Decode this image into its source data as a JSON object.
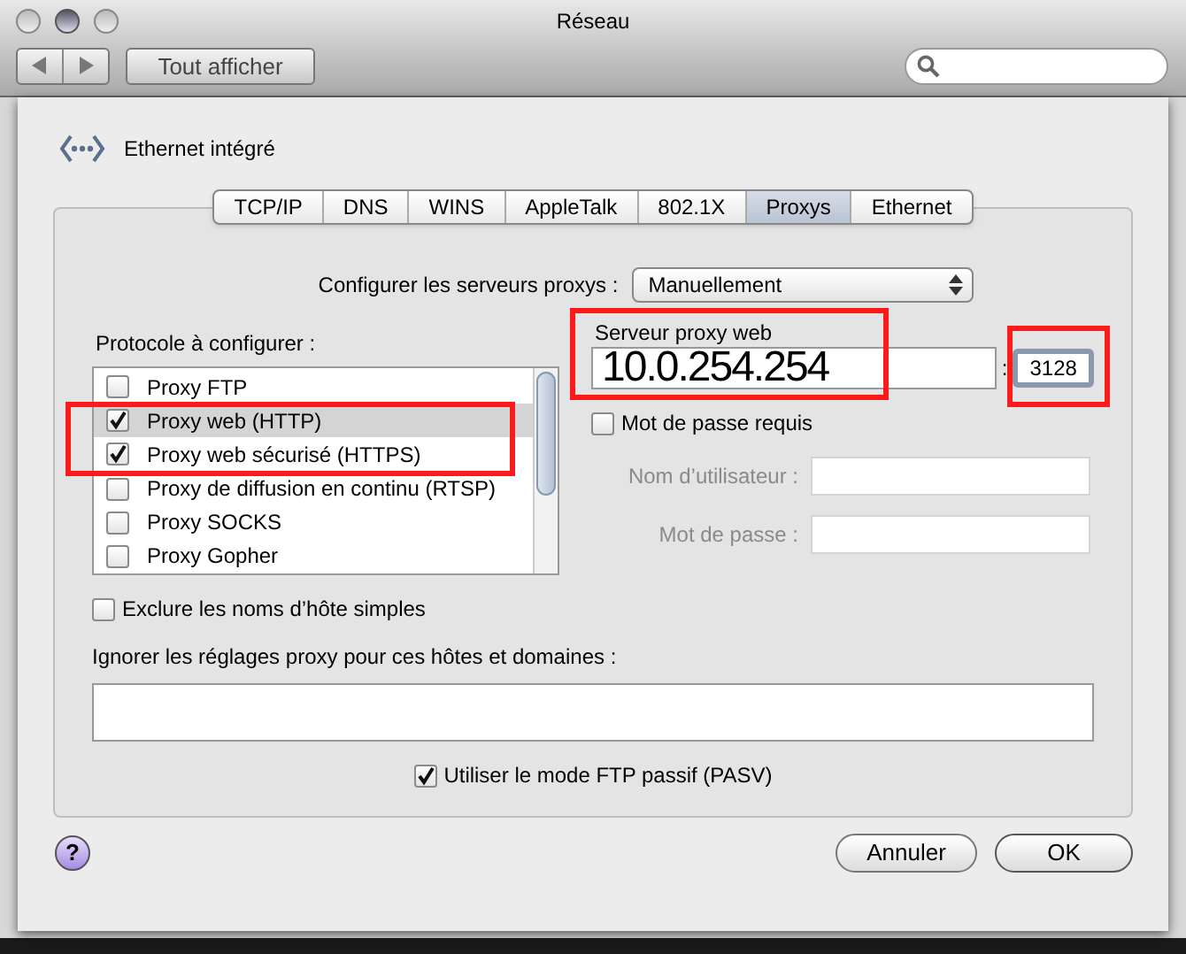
{
  "window": {
    "title": "Réseau"
  },
  "toolbar": {
    "show_all": "Tout afficher"
  },
  "service": {
    "name": "Ethernet intégré"
  },
  "tabs": [
    {
      "label": "TCP/IP",
      "selected": false
    },
    {
      "label": "DNS",
      "selected": false
    },
    {
      "label": "WINS",
      "selected": false
    },
    {
      "label": "AppleTalk",
      "selected": false
    },
    {
      "label": "802.1X",
      "selected": false
    },
    {
      "label": "Proxys",
      "selected": true
    },
    {
      "label": "Ethernet",
      "selected": false
    }
  ],
  "configure": {
    "label": "Configurer les serveurs proxys :",
    "value": "Manuellement"
  },
  "protocols": {
    "label": "Protocole à configurer :",
    "items": [
      {
        "label": "Proxy FTP",
        "checked": false,
        "selected": false
      },
      {
        "label": "Proxy web (HTTP)",
        "checked": true,
        "selected": true
      },
      {
        "label": "Proxy web sécurisé (HTTPS)",
        "checked": true,
        "selected": false
      },
      {
        "label": "Proxy de diffusion en continu (RTSP)",
        "checked": false,
        "selected": false
      },
      {
        "label": "Proxy SOCKS",
        "checked": false,
        "selected": false
      },
      {
        "label": "Proxy Gopher",
        "checked": false,
        "selected": false
      }
    ]
  },
  "server": {
    "label": "Serveur proxy web",
    "host": "10.0.254.254",
    "separator": ":",
    "port": "3128"
  },
  "password_required": {
    "label": "Mot de passe requis",
    "checked": false
  },
  "credentials": [
    {
      "label": "Nom d’utilisateur :",
      "disabled": true
    },
    {
      "label": "Mot de passe :",
      "disabled": true
    }
  ],
  "exclude_simple": {
    "label": "Exclure les noms d’hôte simples",
    "checked": false
  },
  "bypass": {
    "label": "Ignorer les réglages proxy pour ces hôtes et domaines :"
  },
  "passive_ftp": {
    "label": "Utiliser le mode FTP passif (PASV)",
    "checked": true
  },
  "help": "?",
  "buttons": [
    {
      "label": "Annuler",
      "default": false
    },
    {
      "label": "OK",
      "default": true
    }
  ]
}
